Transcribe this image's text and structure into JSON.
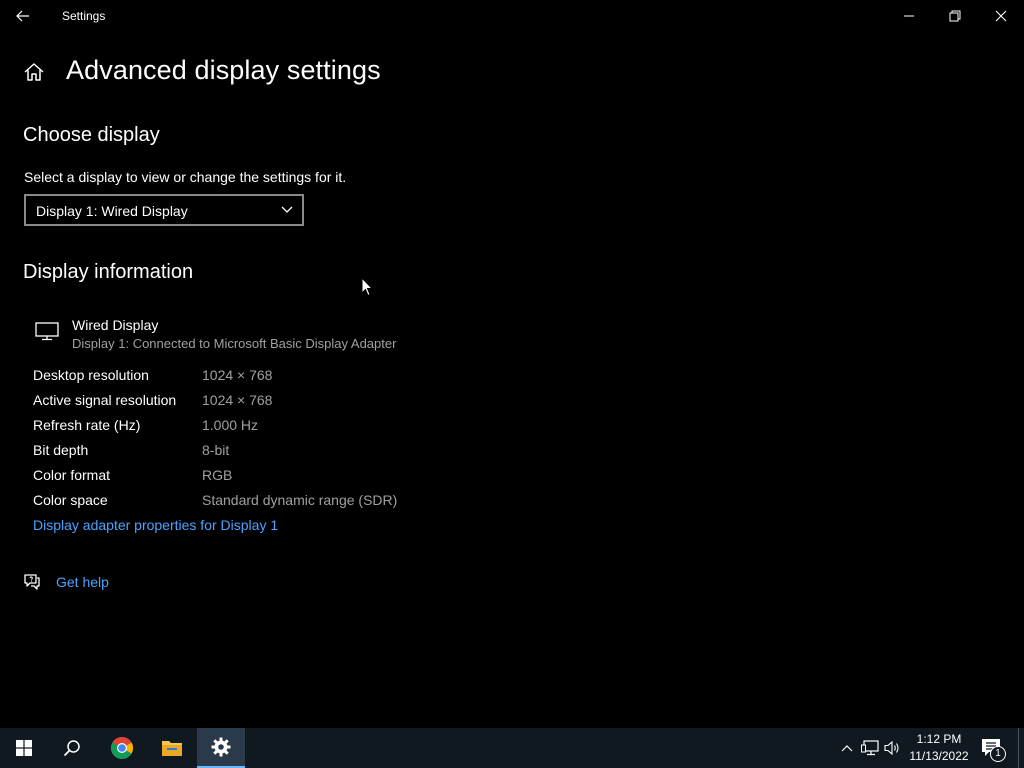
{
  "window": {
    "title": "Settings"
  },
  "page": {
    "title": "Advanced display settings"
  },
  "choose_display": {
    "heading": "Choose display",
    "description": "Select a display to view or change the settings for it.",
    "selected": "Display 1: Wired Display"
  },
  "display_info": {
    "heading": "Display information",
    "name": "Wired Display",
    "subtitle": "Display 1: Connected to Microsoft Basic Display Adapter",
    "rows": [
      {
        "label": "Desktop resolution",
        "value": "1024 × 768"
      },
      {
        "label": "Active signal resolution",
        "value": "1024 × 768"
      },
      {
        "label": "Refresh rate (Hz)",
        "value": "1.000 Hz"
      },
      {
        "label": "Bit depth",
        "value": "8-bit"
      },
      {
        "label": "Color format",
        "value": "RGB"
      },
      {
        "label": "Color space",
        "value": "Standard dynamic range (SDR)"
      }
    ],
    "adapter_link": "Display adapter properties for Display 1"
  },
  "help": {
    "label": "Get help"
  },
  "taskbar": {
    "time": "1:12 PM",
    "date": "11/13/2022",
    "notification_count": "1",
    "icons": [
      "windows-start-icon",
      "search-icon",
      "chrome-icon",
      "file-explorer-icon",
      "settings-gear-icon"
    ],
    "tray_icons": [
      "chevron-up-icon",
      "network-icon",
      "volume-icon",
      "notification-center-icon"
    ]
  },
  "colors": {
    "accent_link": "#4aa3ff",
    "background": "#000000",
    "taskbar": "#101820"
  }
}
